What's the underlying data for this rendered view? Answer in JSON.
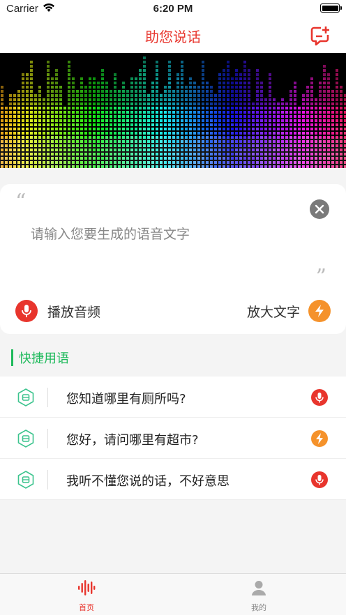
{
  "status_bar": {
    "carrier": "Carrier",
    "time": "6:20 PM"
  },
  "nav": {
    "title": "助您说话",
    "add_icon": "message-add-icon"
  },
  "banner": {
    "image": "rainbow-audio-spectrum"
  },
  "input_card": {
    "placeholder": "请输入您要生成的语音文字",
    "value": "",
    "play_label": "播放音频",
    "zoom_label": "放大文字",
    "quote_open": "“",
    "quote_close": "”"
  },
  "quick_phrases": {
    "title": "快捷用语",
    "items": [
      {
        "text": "您知道哪里有厕所吗?",
        "action": "mic-icon",
        "color": "#e8352d"
      },
      {
        "text": "您好，请问哪里有超市?",
        "action": "bolt-icon",
        "color": "#f5922b"
      },
      {
        "text": "我听不懂您说的话，不好意思",
        "action": "mic-icon",
        "color": "#e8352d"
      }
    ]
  },
  "tab_bar": {
    "tabs": [
      {
        "label": "首页",
        "icon": "waveform-icon",
        "active": true
      },
      {
        "label": "我的",
        "icon": "person-icon",
        "active": false
      }
    ]
  },
  "colors": {
    "accent": "#e8352d",
    "green": "#1fba5c",
    "orange": "#f5922b"
  }
}
